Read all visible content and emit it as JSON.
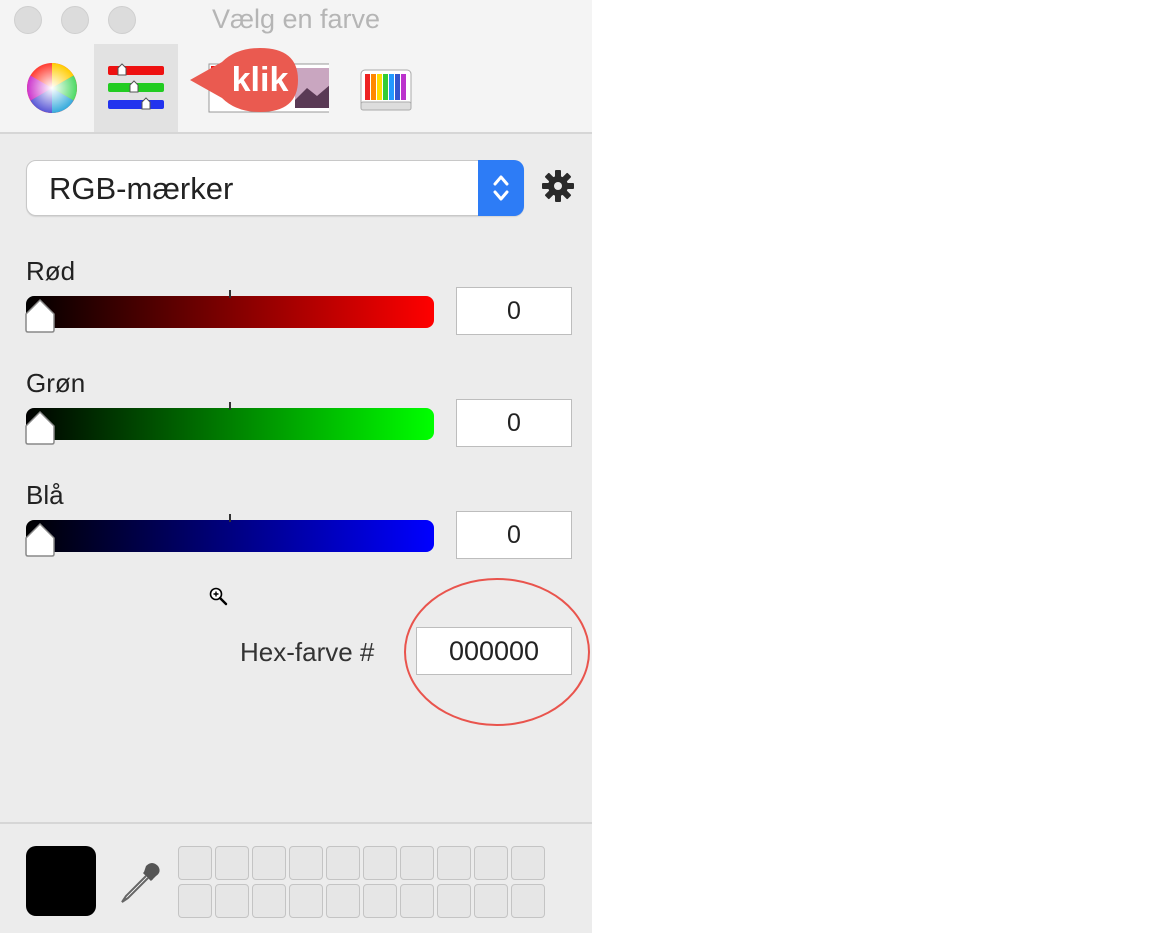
{
  "window": {
    "title": "Vælg en farve"
  },
  "toolbar": {
    "tabs": [
      {
        "name": "color-wheel",
        "icon": "color-wheel-icon",
        "selected": false
      },
      {
        "name": "color-sliders",
        "icon": "sliders-icon",
        "selected": true
      },
      {
        "name": "color-palettes",
        "icon": "image-palette-icon",
        "selected": false
      },
      {
        "name": "pencils",
        "icon": "pencils-icon",
        "selected": false
      }
    ],
    "callout_text": "klik",
    "callout_color": "#ea5a50"
  },
  "mode_select": {
    "value": "RGB-mærker",
    "accent": "#2d7cf6"
  },
  "sliders": [
    {
      "label": "Rød",
      "value": "0",
      "color": "#ff0000"
    },
    {
      "label": "Grøn",
      "value": "0",
      "color": "#00ff00"
    },
    {
      "label": "Blå",
      "value": "0",
      "color": "#0000ff"
    }
  ],
  "hex": {
    "label": "Hex-farve #",
    "value": "000000",
    "highlight_color": "#e9544d"
  },
  "current_color": "#000000"
}
